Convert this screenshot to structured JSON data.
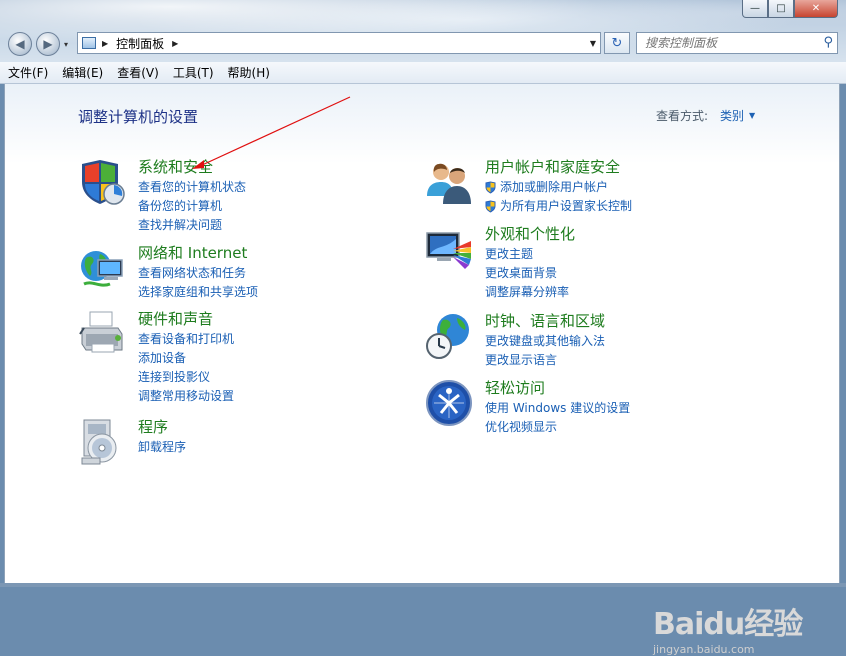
{
  "window": {
    "minimize_glyph": "—",
    "maximize_glyph": "□",
    "close_glyph": "✕"
  },
  "nav": {
    "back_glyph": "◀",
    "forward_glyph": "▶",
    "dropdown_glyph": "▾",
    "address_crumb": "控制面板",
    "crumb_sep": "▶",
    "address_dropdown_glyph": "▼",
    "refresh_glyph": "↻",
    "search_placeholder": "搜索控制面板",
    "search_icon_glyph": "⚲"
  },
  "menu": [
    "文件(F)",
    "编辑(E)",
    "查看(V)",
    "工具(T)",
    "帮助(H)"
  ],
  "page": {
    "title": "调整计算机的设置",
    "view_by_label": "查看方式:",
    "view_by_value": "类别",
    "view_by_glyph": "▼"
  },
  "categories": [
    {
      "title": "系统和安全",
      "links": [
        "查看您的计算机状态",
        "备份您的计算机",
        "查找并解决问题"
      ]
    },
    {
      "title": "网络和 Internet",
      "links": [
        "查看网络状态和任务",
        "选择家庭组和共享选项"
      ]
    },
    {
      "title": "硬件和声音",
      "links": [
        "查看设备和打印机",
        "添加设备",
        "连接到投影仪",
        "调整常用移动设置"
      ]
    },
    {
      "title": "程序",
      "links": [
        "卸载程序"
      ]
    },
    {
      "title": "用户帐户和家庭安全",
      "links": [
        "添加或删除用户帐户",
        "为所有用户设置家长控制"
      ]
    },
    {
      "title": "外观和个性化",
      "links": [
        "更改主题",
        "更改桌面背景",
        "调整屏幕分辨率"
      ]
    },
    {
      "title": "时钟、语言和区域",
      "links": [
        "更改键盘或其他输入法",
        "更改显示语言"
      ]
    },
    {
      "title": "轻松访问",
      "links": [
        "使用 Windows 建议的设置",
        "优化视频显示"
      ]
    }
  ],
  "watermark": {
    "brand": "Baidu经验",
    "url": "jingyan.baidu.com"
  },
  "colors": {
    "category_title": "#1e7c1e",
    "link": "#1a5fb4",
    "page_title": "#1e3287",
    "annotation_arrow": "#e01010"
  }
}
